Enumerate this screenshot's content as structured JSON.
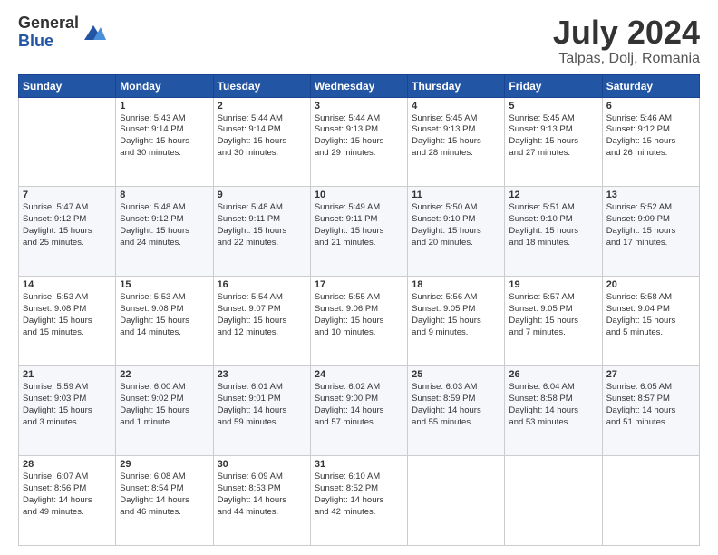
{
  "logo": {
    "general": "General",
    "blue": "Blue"
  },
  "title": "July 2024",
  "location": "Talpas, Dolj, Romania",
  "weekdays": [
    "Sunday",
    "Monday",
    "Tuesday",
    "Wednesday",
    "Thursday",
    "Friday",
    "Saturday"
  ],
  "weeks": [
    [
      {
        "day": "",
        "info": ""
      },
      {
        "day": "1",
        "info": "Sunrise: 5:43 AM\nSunset: 9:14 PM\nDaylight: 15 hours\nand 30 minutes."
      },
      {
        "day": "2",
        "info": "Sunrise: 5:44 AM\nSunset: 9:14 PM\nDaylight: 15 hours\nand 30 minutes."
      },
      {
        "day": "3",
        "info": "Sunrise: 5:44 AM\nSunset: 9:13 PM\nDaylight: 15 hours\nand 29 minutes."
      },
      {
        "day": "4",
        "info": "Sunrise: 5:45 AM\nSunset: 9:13 PM\nDaylight: 15 hours\nand 28 minutes."
      },
      {
        "day": "5",
        "info": "Sunrise: 5:45 AM\nSunset: 9:13 PM\nDaylight: 15 hours\nand 27 minutes."
      },
      {
        "day": "6",
        "info": "Sunrise: 5:46 AM\nSunset: 9:12 PM\nDaylight: 15 hours\nand 26 minutes."
      }
    ],
    [
      {
        "day": "7",
        "info": "Sunrise: 5:47 AM\nSunset: 9:12 PM\nDaylight: 15 hours\nand 25 minutes."
      },
      {
        "day": "8",
        "info": "Sunrise: 5:48 AM\nSunset: 9:12 PM\nDaylight: 15 hours\nand 24 minutes."
      },
      {
        "day": "9",
        "info": "Sunrise: 5:48 AM\nSunset: 9:11 PM\nDaylight: 15 hours\nand 22 minutes."
      },
      {
        "day": "10",
        "info": "Sunrise: 5:49 AM\nSunset: 9:11 PM\nDaylight: 15 hours\nand 21 minutes."
      },
      {
        "day": "11",
        "info": "Sunrise: 5:50 AM\nSunset: 9:10 PM\nDaylight: 15 hours\nand 20 minutes."
      },
      {
        "day": "12",
        "info": "Sunrise: 5:51 AM\nSunset: 9:10 PM\nDaylight: 15 hours\nand 18 minutes."
      },
      {
        "day": "13",
        "info": "Sunrise: 5:52 AM\nSunset: 9:09 PM\nDaylight: 15 hours\nand 17 minutes."
      }
    ],
    [
      {
        "day": "14",
        "info": "Sunrise: 5:53 AM\nSunset: 9:08 PM\nDaylight: 15 hours\nand 15 minutes."
      },
      {
        "day": "15",
        "info": "Sunrise: 5:53 AM\nSunset: 9:08 PM\nDaylight: 15 hours\nand 14 minutes."
      },
      {
        "day": "16",
        "info": "Sunrise: 5:54 AM\nSunset: 9:07 PM\nDaylight: 15 hours\nand 12 minutes."
      },
      {
        "day": "17",
        "info": "Sunrise: 5:55 AM\nSunset: 9:06 PM\nDaylight: 15 hours\nand 10 minutes."
      },
      {
        "day": "18",
        "info": "Sunrise: 5:56 AM\nSunset: 9:05 PM\nDaylight: 15 hours\nand 9 minutes."
      },
      {
        "day": "19",
        "info": "Sunrise: 5:57 AM\nSunset: 9:05 PM\nDaylight: 15 hours\nand 7 minutes."
      },
      {
        "day": "20",
        "info": "Sunrise: 5:58 AM\nSunset: 9:04 PM\nDaylight: 15 hours\nand 5 minutes."
      }
    ],
    [
      {
        "day": "21",
        "info": "Sunrise: 5:59 AM\nSunset: 9:03 PM\nDaylight: 15 hours\nand 3 minutes."
      },
      {
        "day": "22",
        "info": "Sunrise: 6:00 AM\nSunset: 9:02 PM\nDaylight: 15 hours\nand 1 minute."
      },
      {
        "day": "23",
        "info": "Sunrise: 6:01 AM\nSunset: 9:01 PM\nDaylight: 14 hours\nand 59 minutes."
      },
      {
        "day": "24",
        "info": "Sunrise: 6:02 AM\nSunset: 9:00 PM\nDaylight: 14 hours\nand 57 minutes."
      },
      {
        "day": "25",
        "info": "Sunrise: 6:03 AM\nSunset: 8:59 PM\nDaylight: 14 hours\nand 55 minutes."
      },
      {
        "day": "26",
        "info": "Sunrise: 6:04 AM\nSunset: 8:58 PM\nDaylight: 14 hours\nand 53 minutes."
      },
      {
        "day": "27",
        "info": "Sunrise: 6:05 AM\nSunset: 8:57 PM\nDaylight: 14 hours\nand 51 minutes."
      }
    ],
    [
      {
        "day": "28",
        "info": "Sunrise: 6:07 AM\nSunset: 8:56 PM\nDaylight: 14 hours\nand 49 minutes."
      },
      {
        "day": "29",
        "info": "Sunrise: 6:08 AM\nSunset: 8:54 PM\nDaylight: 14 hours\nand 46 minutes."
      },
      {
        "day": "30",
        "info": "Sunrise: 6:09 AM\nSunset: 8:53 PM\nDaylight: 14 hours\nand 44 minutes."
      },
      {
        "day": "31",
        "info": "Sunrise: 6:10 AM\nSunset: 8:52 PM\nDaylight: 14 hours\nand 42 minutes."
      },
      {
        "day": "",
        "info": ""
      },
      {
        "day": "",
        "info": ""
      },
      {
        "day": "",
        "info": ""
      }
    ]
  ]
}
